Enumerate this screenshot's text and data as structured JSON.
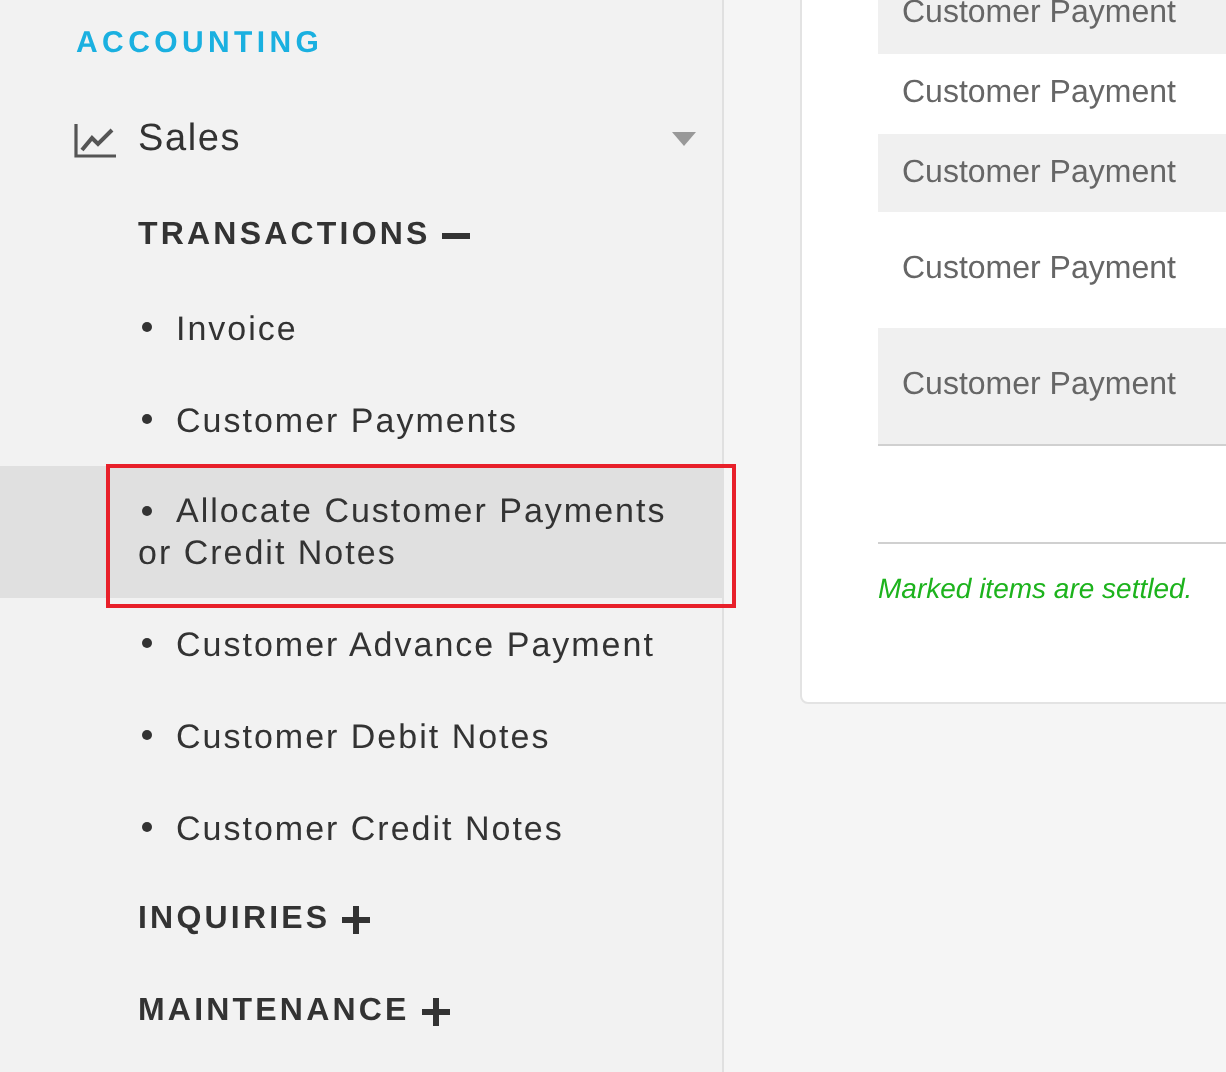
{
  "sidebar": {
    "module": "ACCOUNTING",
    "group": {
      "label": "Sales",
      "expanded": true
    },
    "sections": [
      {
        "label": "TRANSACTIONS",
        "expanded": true,
        "items": [
          {
            "label": "Invoice",
            "selected": false,
            "highlighted": false
          },
          {
            "label": "Customer Payments",
            "selected": false,
            "highlighted": false
          },
          {
            "label": "Allocate Customer Payments or Credit Notes",
            "selected": true,
            "highlighted": true
          },
          {
            "label": "Customer Advance Payment",
            "selected": false,
            "highlighted": false
          },
          {
            "label": "Customer Debit Notes",
            "selected": false,
            "highlighted": false
          },
          {
            "label": "Customer Credit Notes",
            "selected": false,
            "highlighted": false
          }
        ]
      },
      {
        "label": "INQUIRIES",
        "expanded": false
      },
      {
        "label": "MAINTENANCE",
        "expanded": false
      }
    ]
  },
  "table": {
    "rows": [
      {
        "column_1": "Customer Payment"
      },
      {
        "column_1": "Customer Payment"
      },
      {
        "column_1": "Customer Payment"
      },
      {
        "column_1": "Customer Payment"
      },
      {
        "column_1": "Customer Payment"
      }
    ]
  },
  "note": "Marked items are settled."
}
